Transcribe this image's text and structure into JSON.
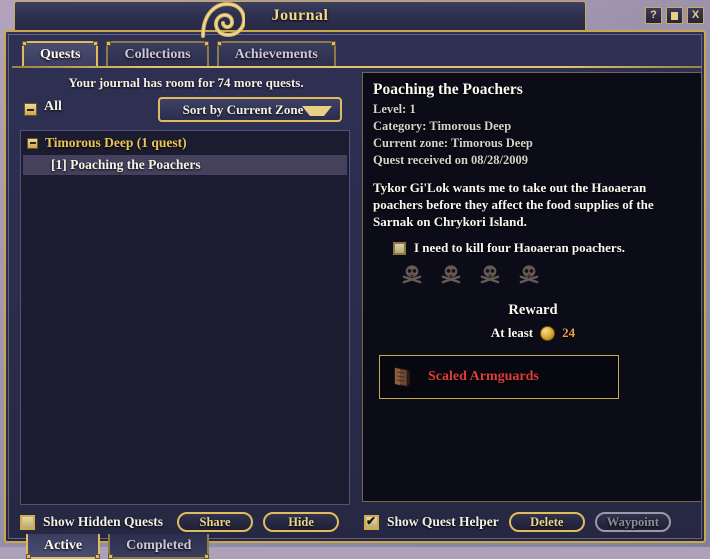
{
  "window": {
    "title": "Journal",
    "buttons": [
      {
        "name": "help-button",
        "glyph": "?"
      },
      {
        "name": "minimize-button",
        "glyph": "square"
      },
      {
        "name": "close-button",
        "glyph": "X"
      }
    ]
  },
  "tabs": [
    {
      "label": "Quests",
      "active": true
    },
    {
      "label": "Collections",
      "active": false
    },
    {
      "label": "Achievements",
      "active": false
    }
  ],
  "left": {
    "room_message": "Your journal has room for 74 more quests.",
    "filter_label": "All",
    "sort_value": "Sort by Current Zone",
    "group": {
      "label": "Timorous Deep (1 quest)"
    },
    "quests": [
      {
        "label": "[1] Poaching the Poachers",
        "selected": true
      }
    ],
    "show_hidden_label": "Show Hidden Quests",
    "show_hidden_checked": false,
    "share_label": "Share",
    "hide_label": "Hide"
  },
  "detail": {
    "title": "Poaching the Poachers",
    "level": "Level: 1",
    "category": "Category: Timorous Deep",
    "current_zone": "Current zone: Timorous Deep",
    "received": "Quest received on 08/28/2009",
    "description": "Tykor Gi'Lok wants me to take out the Haoaeran poachers before they affect the food supplies of the Sarnak on Chrykori Island.",
    "objective": "I need to kill four Haoaeran poachers.",
    "objective_checked": false,
    "kill_markers": 4,
    "reward_title": "Reward",
    "reward_prefix": "At least",
    "reward_amount": "24",
    "reward_item": "Scaled Armguards",
    "show_helper_label": "Show Quest Helper",
    "show_helper_checked": true,
    "delete_label": "Delete",
    "waypoint_label": "Waypoint",
    "waypoint_disabled": true
  },
  "bottom_tabs": [
    {
      "label": "Active",
      "active": true
    },
    {
      "label": "Completed",
      "active": false
    }
  ],
  "colors": {
    "gold_border": "#c9a84c",
    "gold_text": "#edc557",
    "panel_bg": "#2b2d4c",
    "detail_bg": "#0b0c18",
    "item_red": "#e03c3c",
    "coin_amount": "#e89f42"
  }
}
